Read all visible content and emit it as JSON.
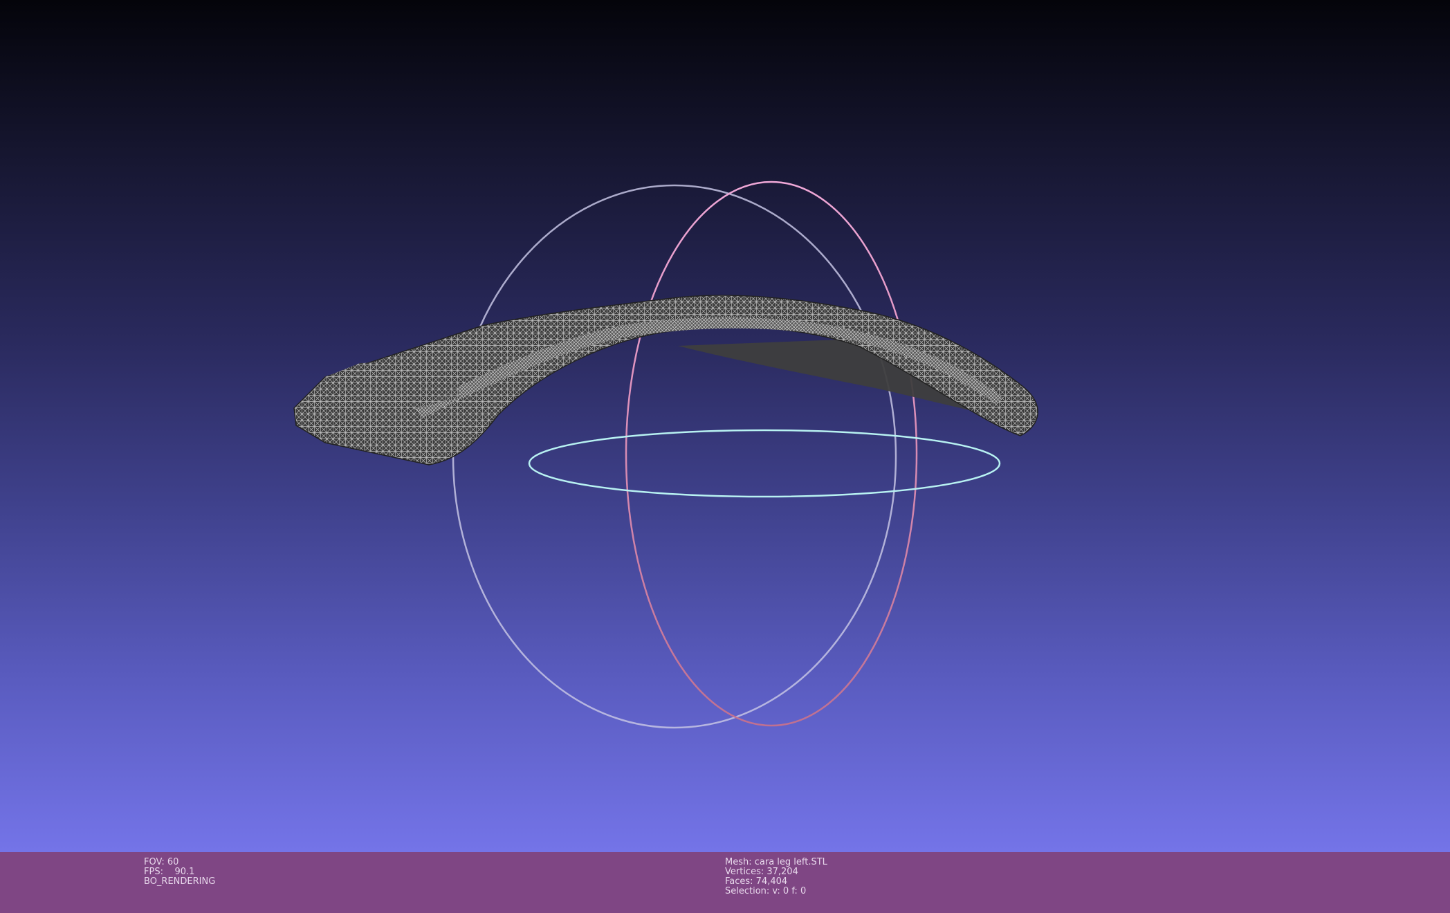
{
  "viewport": {
    "background_top": "#04040a",
    "background_bottom": "#7474e8",
    "mesh_color": "#d8d8d8",
    "trackball": {
      "horizontal_ring_color": "#b8f0f0",
      "vertical_ring_color": "#e8a8d8",
      "side_ring_color": "#c8c8e8"
    }
  },
  "status": {
    "fov": "FOV: 60",
    "fps": "FPS:    90.1",
    "render_mode": "BO_RENDERING",
    "mesh": "Mesh: cara leg left.STL",
    "vertices": "Vertices: 37,204",
    "faces": "Faces: 74,404",
    "selection": "Selection: v: 0 f: 0"
  }
}
